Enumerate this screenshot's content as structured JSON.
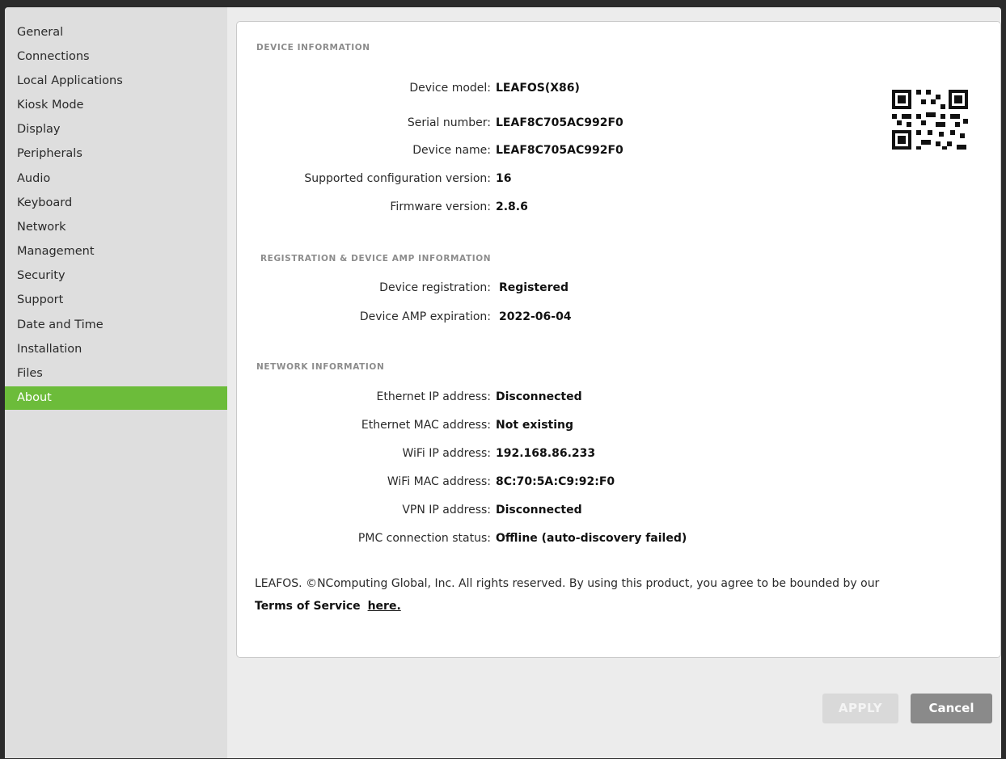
{
  "sidebar": {
    "items": [
      {
        "label": "General"
      },
      {
        "label": "Connections"
      },
      {
        "label": "Local Applications"
      },
      {
        "label": "Kiosk Mode"
      },
      {
        "label": "Display"
      },
      {
        "label": "Peripherals"
      },
      {
        "label": "Audio"
      },
      {
        "label": "Keyboard"
      },
      {
        "label": "Network"
      },
      {
        "label": "Management"
      },
      {
        "label": "Security"
      },
      {
        "label": "Support"
      },
      {
        "label": "Date and Time"
      },
      {
        "label": "Installation"
      },
      {
        "label": "Files"
      },
      {
        "label": "About"
      }
    ],
    "active_item": "About",
    "active_color": "#6cbc3a"
  },
  "device_info": {
    "title": "DEVICE INFORMATION",
    "rows": [
      {
        "label": "Device model:",
        "value": "LEAFOS(X86)"
      },
      {
        "label": "Serial number:",
        "value": "LEAF8C705AC992F0"
      },
      {
        "label": "Device name:",
        "value": "LEAF8C705AC992F0"
      },
      {
        "label": "Supported configuration version:",
        "value": "16"
      },
      {
        "label": "Firmware version:",
        "value": "2.8.6"
      }
    ],
    "qr_icon": "qr-code-icon"
  },
  "registration": {
    "title": "REGISTRATION & DEVICE AMP INFORMATION",
    "rows": [
      {
        "label": "Device registration:",
        "value": "Registered"
      },
      {
        "label": "Device AMP expiration:",
        "value": "2022-06-04"
      }
    ]
  },
  "network": {
    "title": "NETWORK INFORMATION",
    "rows": [
      {
        "label": "Ethernet IP address:",
        "value": "Disconnected"
      },
      {
        "label": "Ethernet MAC address:",
        "value": "Not existing"
      },
      {
        "label": "WiFi IP address:",
        "value": "192.168.86.233"
      },
      {
        "label": "WiFi MAC address:",
        "value": "8C:70:5A:C9:92:F0"
      },
      {
        "label": "VPN IP address:",
        "value": "Disconnected"
      },
      {
        "label": "PMC connection status:",
        "value": "Offline (auto-discovery failed)"
      }
    ]
  },
  "footer": {
    "text": "LEAFOS. ©NComputing Global, Inc. All rights reserved. By using this product, you agree to be bounded by our",
    "terms_label": "Terms of Service",
    "link_label": "here."
  },
  "buttons": {
    "apply_label": "APPLY",
    "cancel_label": "Cancel"
  }
}
